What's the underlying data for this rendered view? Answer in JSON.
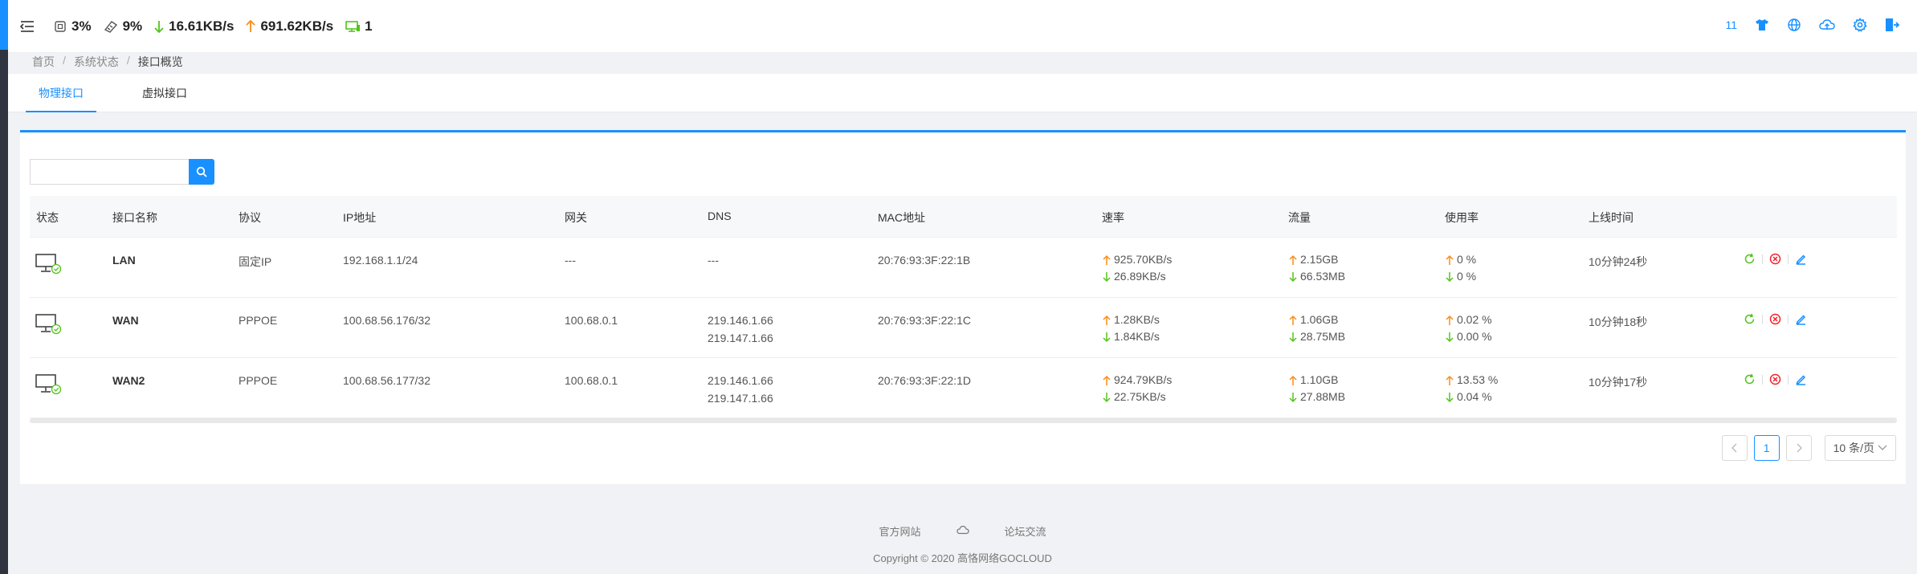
{
  "stats": {
    "cpu": "3%",
    "mem": "9%",
    "down": "16.61KB/s",
    "up": "691.62KB/s",
    "devices": "1"
  },
  "top_right": {
    "notif_count": "11"
  },
  "breadcrumb": [
    "首页",
    "系统状态",
    "接口概览"
  ],
  "tabs": [
    "物理接口",
    "虚拟接口"
  ],
  "search": {
    "placeholder": ""
  },
  "columns": [
    "状态",
    "接口名称",
    "协议",
    "IP地址",
    "网关",
    "DNS",
    "MAC地址",
    "速率",
    "流量",
    "使用率",
    "上线时间"
  ],
  "rows": [
    {
      "name": "LAN",
      "protocol": "固定IP",
      "ip": "192.168.1.1/24",
      "gateway": "---",
      "dns": [
        "---",
        ""
      ],
      "mac": "20:76:93:3F:22:1B",
      "rate_up": "925.70KB/s",
      "rate_down": "26.89KB/s",
      "flow_up": "2.15GB",
      "flow_down": "66.53MB",
      "use_up": "0 %",
      "use_down": "0 %",
      "uptime": "10分钟24秒"
    },
    {
      "name": "WAN",
      "protocol": "PPPOE",
      "ip": "100.68.56.176/32",
      "gateway": "100.68.0.1",
      "dns": [
        "219.146.1.66",
        "219.147.1.66"
      ],
      "mac": "20:76:93:3F:22:1C",
      "rate_up": "1.28KB/s",
      "rate_down": "1.84KB/s",
      "flow_up": "1.06GB",
      "flow_down": "28.75MB",
      "use_up": "0.02 %",
      "use_down": "0.00 %",
      "uptime": "10分钟18秒"
    },
    {
      "name": "WAN2",
      "protocol": "PPPOE",
      "ip": "100.68.56.177/32",
      "gateway": "100.68.0.1",
      "dns": [
        "219.146.1.66",
        "219.147.1.66"
      ],
      "mac": "20:76:93:3F:22:1D",
      "rate_up": "924.79KB/s",
      "rate_down": "22.75KB/s",
      "flow_up": "1.10GB",
      "flow_down": "27.88MB",
      "use_up": "13.53 %",
      "use_down": "0.04 %",
      "uptime": "10分钟17秒"
    }
  ],
  "pagination": {
    "current": "1",
    "page_size": "10 条/页"
  },
  "footer": {
    "link_official": "官方网站",
    "link_forum": "论坛交流",
    "copyright": "Copyright © 2020 高恪网络GOCLOUD"
  },
  "colors": {
    "accent": "#1890ff",
    "up_arrow": "#fa8c16",
    "down_arrow": "#52c41a",
    "delete": "#f5222d"
  }
}
